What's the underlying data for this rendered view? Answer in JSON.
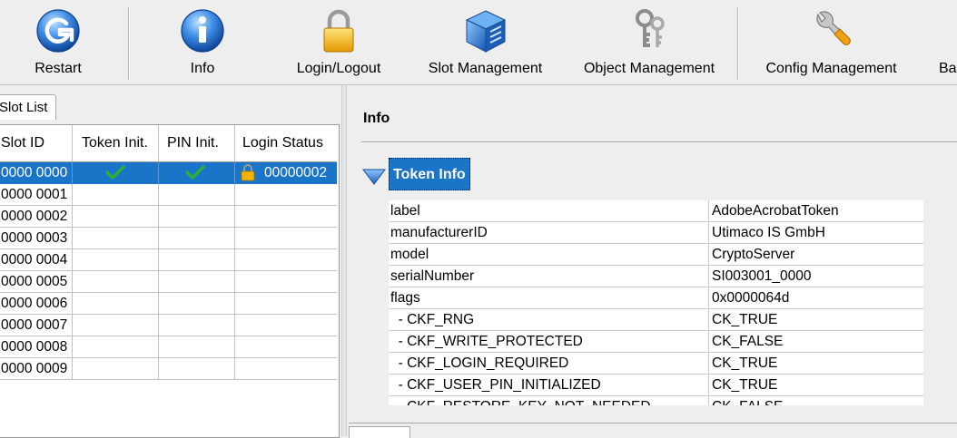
{
  "toolbar": {
    "restart_label": "Restart",
    "info_label": "Info",
    "login_label": "Login/Logout",
    "slot_label": "Slot Management",
    "object_label": "Object Management",
    "config_label": "Config Management",
    "backup_label": "Ba"
  },
  "slot_list": {
    "tab_label": "Slot List",
    "columns": [
      "Slot ID",
      "Token Init.",
      "PIN Init.",
      "Login Status"
    ],
    "rows": [
      {
        "id": "0000 0000",
        "token_init": true,
        "pin_init": true,
        "locked": true,
        "login_status": "00000002",
        "selected": true
      },
      {
        "id": "0000 0001",
        "login_status": ""
      },
      {
        "id": "0000 0002",
        "login_status": ""
      },
      {
        "id": "0000 0003",
        "login_status": ""
      },
      {
        "id": "0000 0004",
        "login_status": ""
      },
      {
        "id": "0000 0005",
        "login_status": ""
      },
      {
        "id": "0000 0006",
        "login_status": ""
      },
      {
        "id": "0000 0007",
        "login_status": ""
      },
      {
        "id": "0000 0008",
        "login_status": ""
      },
      {
        "id": "0000 0009",
        "login_status": ""
      }
    ]
  },
  "info": {
    "title": "Info",
    "section_label": "Token Info",
    "properties": [
      {
        "key": "label",
        "value": "AdobeAcrobatToken"
      },
      {
        "key": "manufacturerID",
        "value": "Utimaco IS GmbH"
      },
      {
        "key": "model",
        "value": "CryptoServer"
      },
      {
        "key": "serialNumber",
        "value": "SI003001_0000"
      },
      {
        "key": "flags",
        "value": "0x0000064d"
      },
      {
        "key": "  - CKF_RNG",
        "value": "CK_TRUE"
      },
      {
        "key": "  - CKF_WRITE_PROTECTED",
        "value": "CK_FALSE"
      },
      {
        "key": "  - CKF_LOGIN_REQUIRED",
        "value": "CK_TRUE"
      },
      {
        "key": "  - CKF_USER_PIN_INITIALIZED",
        "value": "CK_TRUE"
      },
      {
        "key": "  - CKF_RESTORE_KEY_NOT_NEEDED",
        "value": "CK_FALSE"
      }
    ]
  },
  "colors": {
    "selection": "#1a74c8",
    "check": "#2db52d",
    "lock": "#f2b400"
  }
}
